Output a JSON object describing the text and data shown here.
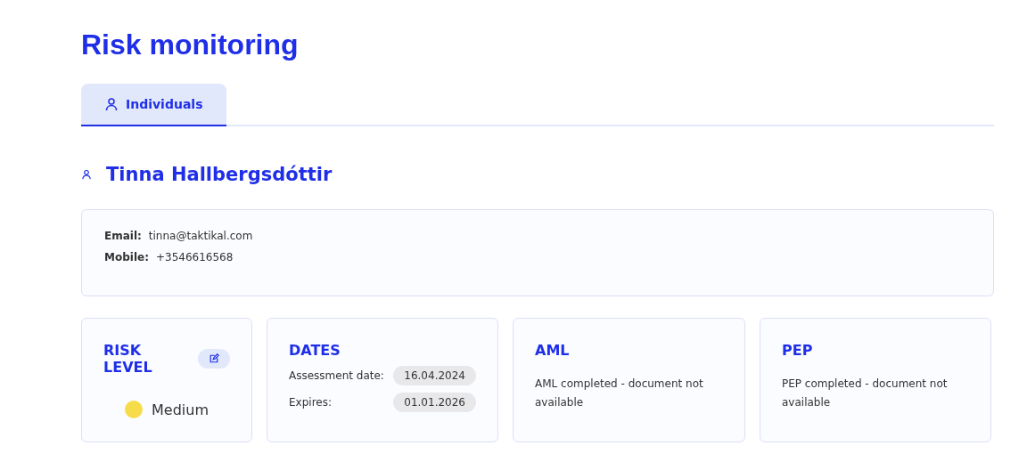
{
  "title": "Risk monitoring",
  "tabs": [
    {
      "label": "Individuals",
      "selected": true
    }
  ],
  "person": {
    "name": "Tinna Hallbergsdóttir"
  },
  "contact": [
    {
      "label": "Email:",
      "value": "tinna@taktikal.com"
    },
    {
      "label": "Mobile:",
      "value": "+3546616568"
    }
  ],
  "cards": [
    {
      "kind": "risk",
      "title": "RISK LEVEL",
      "level_label": "Medium",
      "color": "#f7dc4a"
    },
    {
      "kind": "dates",
      "title": "DATES",
      "rows": [
        {
          "label": "Assessment date:",
          "value": "16.04.2024"
        },
        {
          "label": "Expires:",
          "value": "01.01.2026"
        }
      ]
    },
    {
      "kind": "text",
      "title": "AML",
      "text": "AML completed - document not available"
    },
    {
      "kind": "text",
      "title": "PEP",
      "text": "PEP completed - document not available"
    }
  ]
}
